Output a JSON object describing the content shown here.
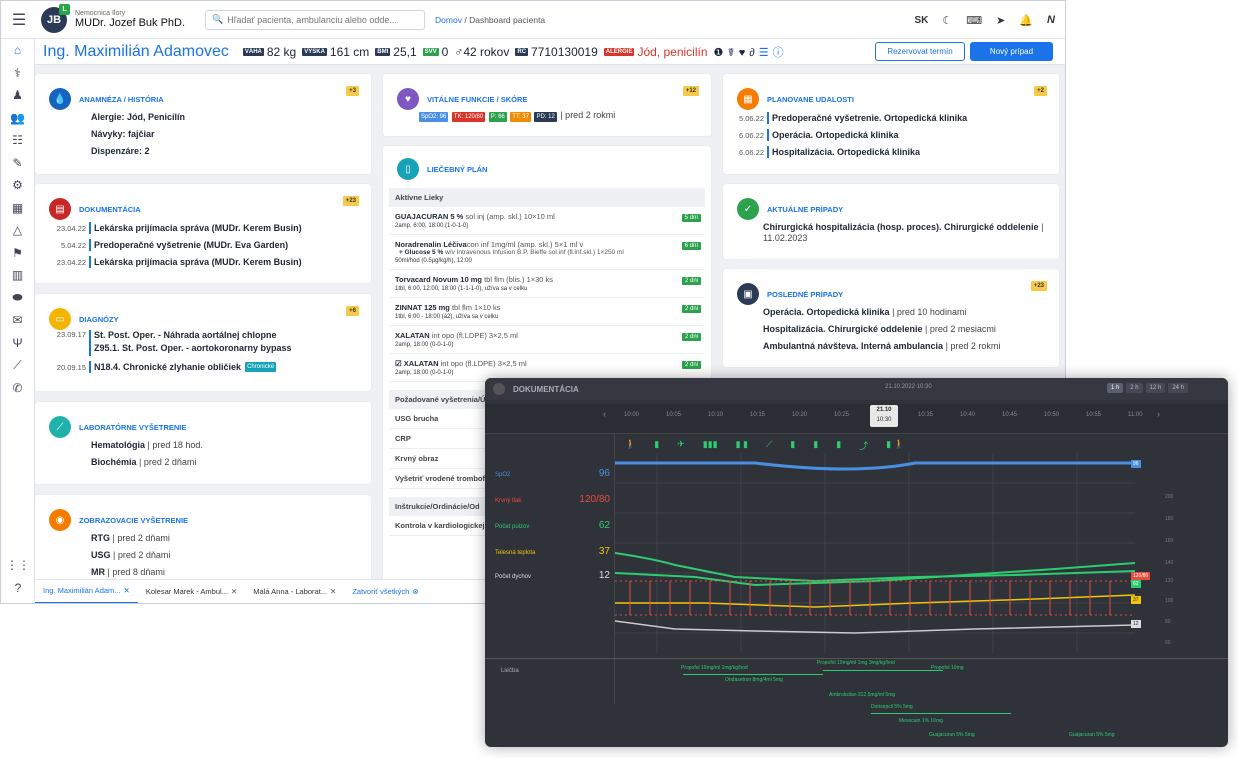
{
  "topbar": {
    "hospital": "Nemocnica Ilory",
    "doctor": "MUDr. Jozef Buk PhD.",
    "avatar_initials": "JB",
    "search_placeholder": "Hľadať pacienta, ambulanciu alebo odde...",
    "breadcrumb_home": "Domov",
    "breadcrumb_sep": " / ",
    "breadcrumb_page": "Dashboard pacienta",
    "lang": "SK"
  },
  "patient": {
    "name": "Ing. Maximilián Adamovec",
    "weight_label": "VÁHA",
    "weight": "82 kg",
    "height_label": "VÝŠKA",
    "height": "161 cm",
    "bmi_label": "BMI",
    "bmi": "25,1",
    "svv_label": "SVV",
    "svv": "0",
    "age": "♂42 rokov",
    "rc_label": "RČ",
    "rc": "7710130019",
    "allergy_label": "ALERGIE",
    "allergy": "Jód, penicilín",
    "btn_reserve": "Rezervovat termín",
    "btn_new": "Nový prípad"
  },
  "anamneza": {
    "title": "ANAMNÉZA / HISTÓRIA",
    "badge": "+3",
    "rows": [
      "Alergie: Jód, Penicilín",
      "Návyky: fajčiar",
      "Dispenzáre: 2"
    ]
  },
  "dokumentacia": {
    "title": "DOKUMENTÁCIA",
    "badge": "+23",
    "rows": [
      {
        "date": "23.04.22",
        "text": "Lekárska prijímacia správa (MUDr. Kerem Busin)"
      },
      {
        "date": "5.04.22",
        "text": "Predoperačné vyšetrenie (MUDr. Eva Garden)"
      },
      {
        "date": "23.04.22",
        "text": "Lekárska prijímacia správa (MUDr. Kerem Busin)"
      }
    ]
  },
  "diagnozy": {
    "title": "DIAGNÓZY",
    "badge": "+6",
    "r1_date": "23.09.17",
    "r1_a": "St. Post. Oper. - Náhrada aortálnej chlopne",
    "r1_b": "Z95.1. St. Post. Oper. - aortokoronarny bypass",
    "r2_date": "20.09.15",
    "r2_text": "N18.4. Chronické zlyhanie obličiek",
    "r2_tag": "Chronické"
  },
  "lab": {
    "title": "LABORATÓRNE VYŠETRENIE",
    "rows": [
      {
        "name": "Hematológia",
        "when": " | pred 18 hod."
      },
      {
        "name": "Biochémia",
        "when": " | pred 2 dňami"
      }
    ]
  },
  "zobraz": {
    "title": "ZOBRAZOVACIE VYŠETRENIE",
    "rows": [
      {
        "name": "RTG",
        "when": " | pred 2 dňami"
      },
      {
        "name": "USG",
        "when": " | pred 2 dňami"
      },
      {
        "name": "MR",
        "when": " | pred 8 dňami"
      }
    ]
  },
  "vitalne": {
    "title": "VITÁLNE FUNKCIE / SKÓRE",
    "badge": "+12",
    "chips": [
      {
        "t": "SpO2: 96",
        "c": "#4a90e2"
      },
      {
        "t": "TK: 120/80",
        "c": "#d9342b"
      },
      {
        "t": "P: 66",
        "c": "#2ca24c"
      },
      {
        "t": "TT: 37",
        "c": "#f08c00"
      },
      {
        "t": "PD: 12",
        "c": "#2b3a55"
      }
    ],
    "when": " | pred 2 rokmi"
  },
  "plan": {
    "title": "LIEČEBNÝ PLÁN",
    "active_header": "Aktívne Lieky",
    "meds": [
      {
        "n": "GUAJACURAN 5 %",
        "d": " sol inj (amp. skl.) 10×10 ml",
        "s": "2amp, 6:00, 18:00 (1-0-1-0)",
        "b": "5 dní"
      },
      {
        "n": "Noradrenalin Léčiva",
        "d": "con inf 1mg/ml (amp. skl.) 5×1 ml v",
        "n2": "+ Glucose 5 %",
        "d2": " w/v Intravenous Infusion B.P. Bieffe sol inf (fl.inf.skl.) 1×250 ml",
        "s": "50ml/hod (0.5µg/kg/h), 12:00",
        "b": "6 dní"
      },
      {
        "n": "Torvacard Novum 10 mg",
        "d": " tbl flm (blis.) 1×30 ks",
        "s": "1tbl, 6:00, 12:00, 18:00 (1-1-1-0), užíva sa v celku",
        "b": "2 dni"
      },
      {
        "n": "ZINNAT 125 mg",
        "d": " tbl flm 1×10 ks",
        "s": "1tbl, 6:00 - 18:00 (á2), užíva sa v celku",
        "b": "2 dni"
      },
      {
        "n": "XALATAN",
        "d": " int opo (fl.LDPE) 3×2,5 ml",
        "s": "2amp, 18:00 (0-0-1-0)",
        "b": "2 dni"
      },
      {
        "n": "☑ XALATAN",
        "d": " int opo (fl.LDPE) 3×2,5 ml",
        "s": "2amp, 18:00 (0-0-1-0)",
        "b": "2 dni"
      }
    ],
    "req_header": "Požadované vyšetrenia/Úk",
    "reqs": [
      "USG brucha",
      "CRP",
      "Krvný obraz",
      "Vyšetriť vrodené trombof"
    ],
    "instr_header": "Inštrukcie/Ordinácie/Od",
    "instr": [
      "Kontrola v kardiologickej"
    ]
  },
  "udalosti": {
    "title": "PLANOVANE UDALOSTI",
    "badge": "+2",
    "rows": [
      {
        "date": "5.06.22",
        "text": "Predoperačné vyšetrenie. Ortopedická klinika"
      },
      {
        "date": "6.06.22",
        "text": "Operácia. Ortopedická klinika"
      },
      {
        "date": "6.06.22",
        "text": "Hospitalizácia. Ortopedická klinika"
      }
    ]
  },
  "aktualne": {
    "title": "AKTUÁLNE PRÍPADY",
    "text": "Chirurgická hospitalizácia (hosp. proces). Chirurgické oddelenie",
    "date": " | 11.02.2023"
  },
  "posledne": {
    "title": "POSLEDNÉ PRÍPADY",
    "badge": "+23",
    "rows": [
      {
        "name": "Operácia. Ortopedická klinika",
        "when": " | pred 10 hodinami"
      },
      {
        "name": "Hospitalizácia. Chirurgické oddelenie",
        "when": " | pred 2 mesiacmi"
      },
      {
        "name": "Ambulantná návšteva. Interná ambulancia",
        "when": " | pred 2 rokmi"
      }
    ]
  },
  "tabs": [
    {
      "label": "Ing. Maximilián Adam...",
      "active": true
    },
    {
      "label": "Kolesar Marek - Ambul...",
      "active": false
    },
    {
      "label": "Malá Anna - Laborat...",
      "active": false
    }
  ],
  "close_all": "Zatvoriť všetkých",
  "overlay": {
    "title": "DOKUMENTÁCIA",
    "date": "21.10.2022 10:30",
    "ranges": [
      "1 h",
      "2 h",
      "12 h",
      "24 h"
    ],
    "times": [
      "10:00",
      "10:05",
      "10:10",
      "10:15",
      "10:20",
      "10:25",
      "",
      "10:35",
      "10:40",
      "10:45",
      "10:50",
      "10:55",
      "11:00"
    ],
    "sel_date": "21.10",
    "sel_time": "10:30",
    "vitals": [
      {
        "label": "SpO2",
        "value": "96",
        "color": "#4a90e2"
      },
      {
        "label": "Krvný tlak",
        "value": "120/80",
        "color": "#e74c3c"
      },
      {
        "label": "Počet pulzov",
        "value": "62",
        "color": "#2ecc71"
      },
      {
        "label": "Telesná teplota",
        "value": "37",
        "color": "#f1c40f"
      },
      {
        "label": "Počet dychov",
        "value": "12",
        "color": "#dddddd"
      }
    ],
    "scale": [
      "200",
      "180",
      "160",
      "140",
      "120",
      "100",
      "80",
      "60"
    ],
    "treatment_label": "Liečba",
    "treatments": [
      "Propofol 10mg/ml 1mg/kg/hod",
      "Propofol 10mg/ml 1mg 3mg/kg/hod",
      "Propofol 10mg",
      "Ondasetron 8mg/4ml 5mg",
      "Ambroksilan 312,5mg/ml 5mg",
      "Dorisepcil 5% 5mg",
      "Mesocain 1% 10mg",
      "Guajacuran 5% 5mg",
      "Guajacuran 5% 5mg"
    ],
    "badges": {
      "spo2": "96",
      "bp": "120/80",
      "pulse": "62",
      "temp": "37",
      "resp": "12"
    }
  }
}
